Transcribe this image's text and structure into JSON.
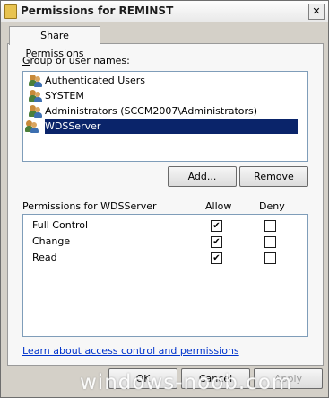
{
  "window": {
    "title": "Permissions for REMINST",
    "close_glyph": "✕"
  },
  "tab": {
    "label": "Share Permissions"
  },
  "users": {
    "label_prefix": "G",
    "label_rest": "roup or user names:",
    "items": [
      {
        "name": "Authenticated Users",
        "icon": "group-icon"
      },
      {
        "name": "SYSTEM",
        "icon": "group-icon"
      },
      {
        "name": "Administrators (SCCM2007\\Administrators)",
        "icon": "group-icon"
      },
      {
        "name": "WDSServer",
        "icon": "group-icon",
        "selected": true
      }
    ]
  },
  "buttons": {
    "add": "Add...",
    "remove": "Remove",
    "ok": "OK",
    "cancel": "Cancel",
    "apply": "Apply"
  },
  "permissions": {
    "header": "Permissions for WDSServer",
    "allow_header": "Allow",
    "deny_header": "Deny",
    "rows": [
      {
        "name": "Full Control",
        "allow": true,
        "deny": false
      },
      {
        "name": "Change",
        "allow": true,
        "deny": false
      },
      {
        "name": "Read",
        "allow": true,
        "deny": false
      }
    ]
  },
  "link": "Learn about access control and permissions",
  "watermark": "windows-noob.com",
  "colors": {
    "selection": "#0a246a",
    "link": "#0033cc",
    "dialog_bg": "#d4d0c8"
  }
}
